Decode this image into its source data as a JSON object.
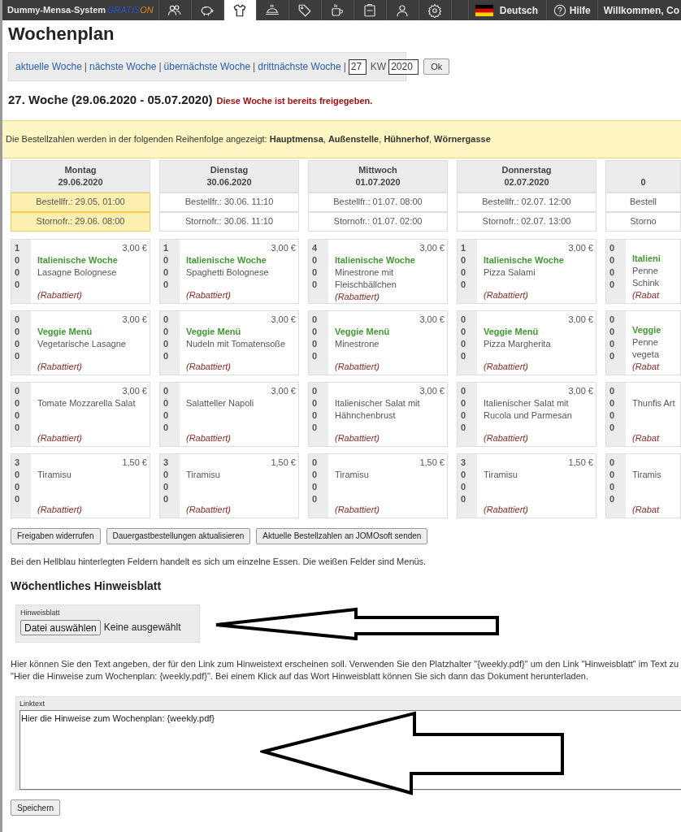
{
  "topbar": {
    "app_name": "Dummy-Mensa-System",
    "logo_part1": "GRATIS",
    "logo_part2": "ON",
    "nav_items": [
      {
        "selected": false
      },
      {
        "selected": false
      },
      {
        "selected": true
      },
      {
        "selected": false
      },
      {
        "selected": false
      },
      {
        "selected": false
      },
      {
        "selected": false
      },
      {
        "selected": false
      },
      {
        "selected": false
      }
    ],
    "language": "Deutsch",
    "help": "Hilfe",
    "welcome": "Willkommen, Co"
  },
  "page_title": "Wochenplan",
  "week_nav": {
    "items": [
      {
        "kind": "link",
        "text": "aktuelle Woche"
      },
      {
        "kind": "sep",
        "text": "|"
      },
      {
        "kind": "link",
        "text": "nächste Woche"
      },
      {
        "kind": "sep",
        "text": "|"
      },
      {
        "kind": "link",
        "text": "übernächste Woche"
      },
      {
        "kind": "sep",
        "text": "|"
      },
      {
        "kind": "link",
        "text": "drittnächste Woche"
      },
      {
        "kind": "sep",
        "text": "|"
      }
    ],
    "week_value": "27",
    "week_label": "KW",
    "year_value": "2020",
    "ok": "Ok"
  },
  "week_heading": "27. Woche (29.06.2020 - 05.07.2020)",
  "week_status": "Diese Woche ist bereits freigegeben.",
  "info": "Die Bestellzahlen werden in der folgenden Reihenfolge angezeigt: **Hauptmensa**, **Außenstelle**, **Hühnerhof**, **Wörnergasse**",
  "days": [
    {
      "name": "Montag",
      "date": "29.06.2020",
      "order_deadline": "Bestellfr.: 29.05. 01:00",
      "cancel_deadline": "Stornofr.: 29.06. 08:00",
      "highlighted": true,
      "meals": [
        {
          "counts": [
            "1",
            "0",
            "0",
            "0"
          ],
          "price": "3,00 €",
          "category": "Italienische Woche",
          "name": "Lasagne Bolognese",
          "note": "(Rabattiert)"
        },
        {
          "counts": [
            "0",
            "0",
            "0",
            "0"
          ],
          "price": "3,00 €",
          "category": "Veggie Menü",
          "name": "Vegetarische Lasagne",
          "note": "(Rabattiert)"
        },
        {
          "counts": [
            "0",
            "0",
            "0",
            "0"
          ],
          "price": "3,00 €",
          "name": "Tomate Mozzarella Salat",
          "note": "(Rabattiert)"
        },
        {
          "counts": [
            "3",
            "0",
            "0",
            "0"
          ],
          "price": "1,50 €",
          "name": "Tiramisu",
          "note": "(Rabattiert)"
        }
      ]
    },
    {
      "name": "Dienstag",
      "date": "30.06.2020",
      "order_deadline": "Bestellfr.: 30.06. 11:10",
      "cancel_deadline": "Stornofr.: 30.06. 11:10",
      "highlighted": false,
      "meals": [
        {
          "counts": [
            "1",
            "0",
            "0",
            "0"
          ],
          "price": "3,00 €",
          "category": "Italienische Woche",
          "name": "Spaghetti Bolognese",
          "note": "(Rabattiert)"
        },
        {
          "counts": [
            "0",
            "0",
            "0",
            "0"
          ],
          "price": "3,00 €",
          "category": "Veggie Menü",
          "name": "Nudeln mit Tomatensoße",
          "note": "(Rabattiert)"
        },
        {
          "counts": [
            "0",
            "0",
            "0",
            "0"
          ],
          "price": "3,00 €",
          "name": "Salatteller Napoli",
          "note": "(Rabattiert)"
        },
        {
          "counts": [
            "3",
            "0",
            "0",
            "0"
          ],
          "price": "1,50 €",
          "name": "Tiramisu",
          "note": "(Rabattiert)"
        }
      ]
    },
    {
      "name": "Mittwoch",
      "date": "01.07.2020",
      "order_deadline": "Bestellfr.: 01.07. 08:00",
      "cancel_deadline": "Stornofr.: 01.07. 02:00",
      "highlighted": false,
      "meals": [
        {
          "counts": [
            "4",
            "0",
            "0",
            "0"
          ],
          "price": "3,00 €",
          "category": "Italienische Woche",
          "name": "Minestrone mit Fleischbällchen",
          "note": "(Rabattiert)"
        },
        {
          "counts": [
            "0",
            "0",
            "0",
            "0"
          ],
          "price": "3,00 €",
          "category": "Veggie Menü",
          "name": "Minestrone",
          "note": "(Rabattiert)"
        },
        {
          "counts": [
            "0",
            "0",
            "0",
            "0"
          ],
          "price": "3,00 €",
          "name": "Italienischer Salat mit Hähnchenbrust",
          "note": "(Rabattiert)"
        },
        {
          "counts": [
            "0",
            "0",
            "0",
            "0"
          ],
          "price": "1,50 €",
          "name": "Tiramisu",
          "note": "(Rabattiert)"
        }
      ]
    },
    {
      "name": "Donnerstag",
      "date": "02.07.2020",
      "order_deadline": "Bestellfr.: 02.07. 12:00",
      "cancel_deadline": "Stornofr.: 02.07. 13:00",
      "highlighted": false,
      "meals": [
        {
          "counts": [
            "1",
            "0",
            "0",
            "0"
          ],
          "price": "3,00 €",
          "category": "Italienische Woche",
          "name": "Pizza Salami",
          "note": "(Rabattiert)"
        },
        {
          "counts": [
            "0",
            "0",
            "0",
            "0"
          ],
          "price": "3,00 €",
          "category": "Veggie Menü",
          "name": "Pizza Margherita",
          "note": "(Rabattiert)"
        },
        {
          "counts": [
            "0",
            "0",
            "0",
            "0"
          ],
          "price": "3,00 €",
          "name": "Italienischer Salat mit Rucola und Parmesan",
          "note": "(Rabattiert)"
        },
        {
          "counts": [
            "3",
            "0",
            "0",
            "0"
          ],
          "price": "1,50 €",
          "name": "Tiramisu",
          "note": "(Rabattiert)"
        }
      ]
    },
    {
      "date": "0",
      "order_deadline": "Bestell",
      "cancel_deadline": "Storno",
      "highlighted": false,
      "meals": [
        {
          "counts": [
            "0",
            "0",
            "0",
            "0"
          ],
          "category": "Italieni",
          "name": "Penne Schink",
          "note": "(Rabat"
        },
        {
          "counts": [
            "0",
            "0",
            "0",
            "0"
          ],
          "category": "Veggie",
          "name": "Penne vegeta",
          "note": "(Rabat"
        },
        {
          "counts": [
            "0",
            "0",
            "0",
            "0"
          ],
          "name": "Thunfis Art",
          "note": "(Rabat"
        },
        {
          "counts": [
            "0",
            "0",
            "0",
            "0"
          ],
          "name": "Tiramis",
          "note": "(Rabat"
        }
      ]
    }
  ],
  "actions": [
    "Freigaben widerrufen",
    "Dauergastbestellungen aktualisieren",
    "Aktuelle Bestellzahlen an JOMOsoft senden"
  ],
  "legend": "Bei den Hellblau hinterlegten Feldern handelt es sich um einzelne Essen. Die weißen Felder sind Menüs.",
  "notice_section": {
    "title": "Wöchentliches Hinweisblatt",
    "file_label": "Hinweisblatt",
    "file_button": "Datei auswählen",
    "file_status": "Keine ausgewählt",
    "help_lines": [
      "Hier können Sie den Text angeben, der für den Link zum Hinweistext erscheinen soll. Verwenden Sie den Platzhalter \"{weekly.pdf}\" um den Link \"Hinweisblatt\" im Text zu",
      "\"Hier die Hinweise zum Wochenplan: {weekly.pdf}\". Bei einem Klick auf das Wort Hinweisblatt können Sie sich dann das Dokument herunterladen."
    ],
    "linktext_label": "Linktext",
    "linktext_value": "Hier die Hinweise zum Wochenplan: {weekly.pdf}",
    "save": "Speichern"
  }
}
